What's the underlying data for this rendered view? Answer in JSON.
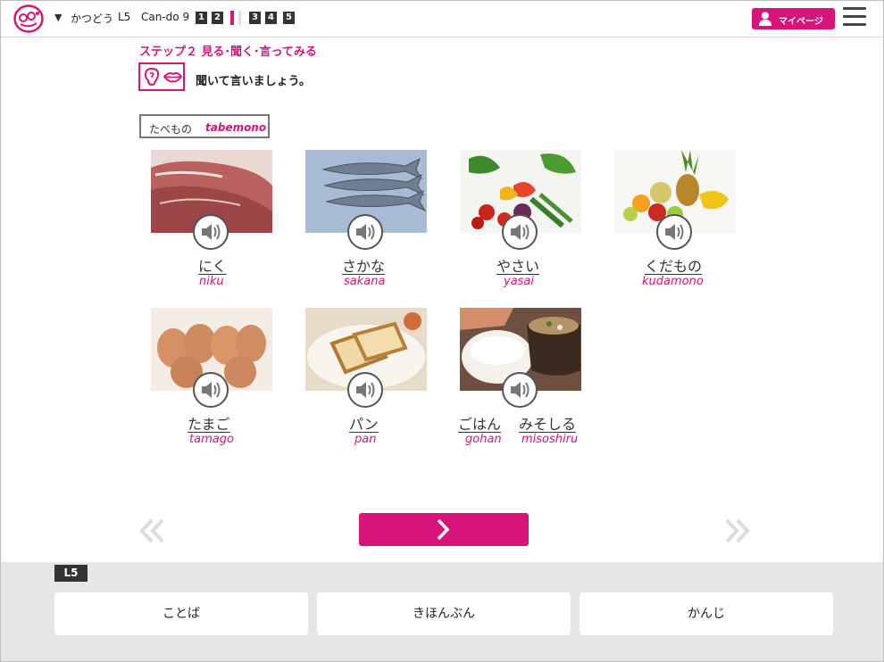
{
  "header": {
    "lesson_title": "かつどう",
    "lesson_code": "L5",
    "cando": "Can-do 9",
    "steps": [
      "1",
      "2",
      "3",
      "4",
      "5"
    ],
    "mypage_label": "マイページ"
  },
  "step": {
    "title": "ステップ２ 見る･聞く･言ってみる",
    "instruction": "聞いて言いましょう。"
  },
  "category": {
    "ja": "たべもの",
    "romaji": "tabemono"
  },
  "items": [
    {
      "word": "にく",
      "romaji": "niku"
    },
    {
      "word": "さかな",
      "romaji": "sakana"
    },
    {
      "word": "やさい",
      "romaji": "yasai"
    },
    {
      "word": "くだもの",
      "romaji": "kudamono"
    },
    {
      "word": "たまご",
      "romaji": "tamago"
    },
    {
      "word": "パン",
      "romaji": "pan"
    },
    {
      "word": "ごはん",
      "romaji": "gohan"
    },
    {
      "word": "みそしる",
      "romaji": "misoshiru"
    }
  ],
  "footer": {
    "tag": "L5",
    "buttons": [
      "ことば",
      "きほんぶん",
      "かんじ"
    ]
  },
  "colors": {
    "accent": "#d6147a",
    "dark": "#333333",
    "footer_bg": "#e6e6e6"
  }
}
